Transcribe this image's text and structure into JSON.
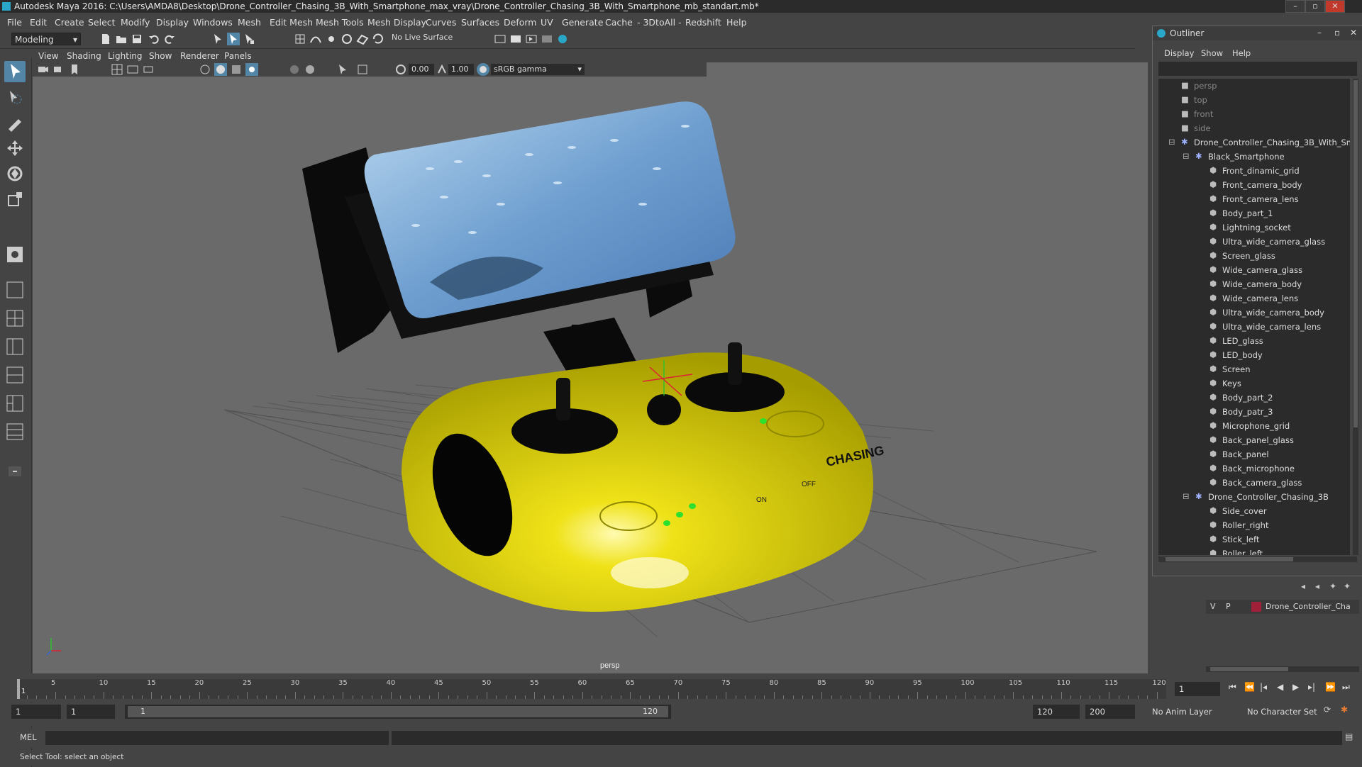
{
  "window": {
    "title": "Autodesk Maya 2016: C:\\Users\\AMDA8\\Desktop\\Drone_Controller_Chasing_3B_With_Smartphone_max_vray\\Drone_Controller_Chasing_3B_With_Smartphone_mb_standart.mb*"
  },
  "menu": [
    "File",
    "Edit",
    "Create",
    "Select",
    "Modify",
    "Display",
    "Windows",
    "Mesh",
    "Edit Mesh",
    "Mesh Tools",
    "Mesh Display",
    "Curves",
    "Surfaces",
    "Deform",
    "UV",
    "Generate",
    "Cache",
    "- 3DtoAll -",
    "Redshift",
    "Help"
  ],
  "status_line": {
    "mode": "Modeling",
    "live_surface": "No Live Surface"
  },
  "viewport": {
    "menu": [
      "View",
      "Shading",
      "Lighting",
      "Show",
      "Renderer",
      "Panels"
    ],
    "exposure": "0.00",
    "gamma": "1.00",
    "color_space": "sRGB gamma",
    "camera_label": "persp",
    "model_brand": "CHASING",
    "switch_on": "ON",
    "switch_off": "OFF"
  },
  "outliner": {
    "title": "Outliner",
    "menu": [
      "Display",
      "Show",
      "Help"
    ],
    "items": [
      {
        "label": "persp",
        "kind": "camera",
        "depth": 1,
        "dim": true
      },
      {
        "label": "top",
        "kind": "camera",
        "depth": 1,
        "dim": true
      },
      {
        "label": "front",
        "kind": "camera",
        "depth": 1,
        "dim": true
      },
      {
        "label": "side",
        "kind": "camera",
        "depth": 1,
        "dim": true
      },
      {
        "label": "Drone_Controller_Chasing_3B_With_Sm",
        "kind": "group",
        "depth": 1,
        "dim": false
      },
      {
        "label": "Black_Smartphone",
        "kind": "group",
        "depth": 2,
        "dim": false
      },
      {
        "label": "Front_dinamic_grid",
        "kind": "mesh",
        "depth": 3,
        "dim": false
      },
      {
        "label": "Front_camera_body",
        "kind": "mesh",
        "depth": 3,
        "dim": false
      },
      {
        "label": "Front_camera_lens",
        "kind": "mesh",
        "depth": 3,
        "dim": false
      },
      {
        "label": "Body_part_1",
        "kind": "mesh",
        "depth": 3,
        "dim": false
      },
      {
        "label": "Lightning_socket",
        "kind": "mesh",
        "depth": 3,
        "dim": false
      },
      {
        "label": "Ultra_wide_camera_glass",
        "kind": "mesh",
        "depth": 3,
        "dim": false
      },
      {
        "label": "Screen_glass",
        "kind": "mesh",
        "depth": 3,
        "dim": false
      },
      {
        "label": "Wide_camera_glass",
        "kind": "mesh",
        "depth": 3,
        "dim": false
      },
      {
        "label": "Wide_camera_body",
        "kind": "mesh",
        "depth": 3,
        "dim": false
      },
      {
        "label": "Wide_camera_lens",
        "kind": "mesh",
        "depth": 3,
        "dim": false
      },
      {
        "label": "Ultra_wide_camera_body",
        "kind": "mesh",
        "depth": 3,
        "dim": false
      },
      {
        "label": "Ultra_wide_camera_lens",
        "kind": "mesh",
        "depth": 3,
        "dim": false
      },
      {
        "label": "LED_glass",
        "kind": "mesh",
        "depth": 3,
        "dim": false
      },
      {
        "label": "LED_body",
        "kind": "mesh",
        "depth": 3,
        "dim": false
      },
      {
        "label": "Screen",
        "kind": "mesh",
        "depth": 3,
        "dim": false
      },
      {
        "label": "Keys",
        "kind": "mesh",
        "depth": 3,
        "dim": false
      },
      {
        "label": "Body_part_2",
        "kind": "mesh",
        "depth": 3,
        "dim": false
      },
      {
        "label": "Body_patr_3",
        "kind": "mesh",
        "depth": 3,
        "dim": false
      },
      {
        "label": "Microphone_grid",
        "kind": "mesh",
        "depth": 3,
        "dim": false
      },
      {
        "label": "Back_panel_glass",
        "kind": "mesh",
        "depth": 3,
        "dim": false
      },
      {
        "label": "Back_panel",
        "kind": "mesh",
        "depth": 3,
        "dim": false
      },
      {
        "label": "Back_microphone",
        "kind": "mesh",
        "depth": 3,
        "dim": false
      },
      {
        "label": "Back_camera_glass",
        "kind": "mesh",
        "depth": 3,
        "dim": false
      },
      {
        "label": "Drone_Controller_Chasing_3B",
        "kind": "group",
        "depth": 2,
        "dim": false
      },
      {
        "label": "Side_cover",
        "kind": "mesh",
        "depth": 3,
        "dim": false
      },
      {
        "label": "Roller_right",
        "kind": "mesh",
        "depth": 3,
        "dim": false
      },
      {
        "label": "Stick_left",
        "kind": "mesh",
        "depth": 3,
        "dim": false
      },
      {
        "label": "Roller_left",
        "kind": "mesh",
        "depth": 3,
        "dim": false
      }
    ]
  },
  "layers": {
    "v": "V",
    "p": "P",
    "layer_name": "Drone_Controller_Cha",
    "layer_color": "#a0203a"
  },
  "timeline": {
    "ticks": [
      "5",
      "10",
      "15",
      "20",
      "25",
      "30",
      "35",
      "40",
      "45",
      "50",
      "55",
      "60",
      "65",
      "70",
      "75",
      "80",
      "85",
      "90",
      "95",
      "100",
      "105",
      "110",
      "115",
      "120"
    ],
    "current_frame": "1",
    "frame_field": "1"
  },
  "range": {
    "start": "1",
    "playback_start": "1",
    "slider_start": "1",
    "slider_end": "120",
    "playback_end": "120",
    "end": "200",
    "anim_layer": "No Anim Layer",
    "character_set": "No Character Set"
  },
  "command": {
    "language": "MEL"
  },
  "help_line": "Select Tool: select an object",
  "colors": {
    "accent": "#5285a6",
    "body_yellow": "#e4d800"
  }
}
